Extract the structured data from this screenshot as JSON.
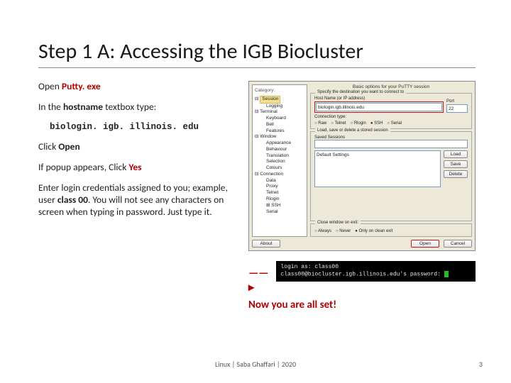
{
  "title": "Step 1 A: Accessing the IGB Biocluster",
  "left": {
    "open_prefix": "Open ",
    "open_target": "Putty. exe",
    "hostname_prefix": "In the ",
    "hostname_bold": "hostname",
    "hostname_suffix": " textbox type:",
    "hostname_value": "biologin. igb. illinois. edu",
    "click_prefix": "Click ",
    "click_open": "Open",
    "popup_prefix": "If popup appears, Click ",
    "popup_yes": "Yes",
    "creds_a": "Enter login credentials assigned to you; example, user ",
    "creds_user": "class 00",
    "creds_b": ". You will not see any characters on screen when typing in password. Just type it."
  },
  "putty": {
    "category_label": "Category:",
    "tree": {
      "session": "Session",
      "logging": "Logging",
      "terminal": "Terminal",
      "keyboard": "Keyboard",
      "bell": "Bell",
      "features": "Features",
      "window": "Window",
      "appearance": "Appearance",
      "behaviour": "Behaviour",
      "translation": "Translation",
      "selection": "Selection",
      "colours": "Colours",
      "connection": "Connection",
      "data": "Data",
      "proxy": "Proxy",
      "telnet": "Telnet",
      "rlogin": "Rlogin",
      "ssh": "SSH",
      "serial": "Serial"
    },
    "panel_title": "Basic options for your PuTTY session",
    "dest_caption": "Specify the destination you want to connect to",
    "host_label": "Host Name (or IP address)",
    "host_value": "biologin.igb.illinois.edu",
    "port_label": "Port",
    "port_value": "22",
    "conn_type_label": "Connection type:",
    "raw": "Raw",
    "telnet_r": "Telnet",
    "rlogin_r": "Rlogin",
    "ssh_r": "SSH",
    "serial_r": "Serial",
    "sessions_caption": "Load, save or delete a stored session",
    "saved_label": "Saved Sessions",
    "default_settings": "Default Settings",
    "load": "Load",
    "save": "Save",
    "delete": "Delete",
    "close_caption": "Close window on exit:",
    "always": "Always",
    "never": "Never",
    "clean": "Only on clean exit",
    "about": "About",
    "open": "Open",
    "cancel": "Cancel"
  },
  "terminal": {
    "line1": "login as: class00",
    "line2": "class00@biocluster.igb.illinois.edu's password:"
  },
  "allset": "Now you are all set!",
  "footer": "Linux | Saba Ghaffari | 2020",
  "page": "3"
}
